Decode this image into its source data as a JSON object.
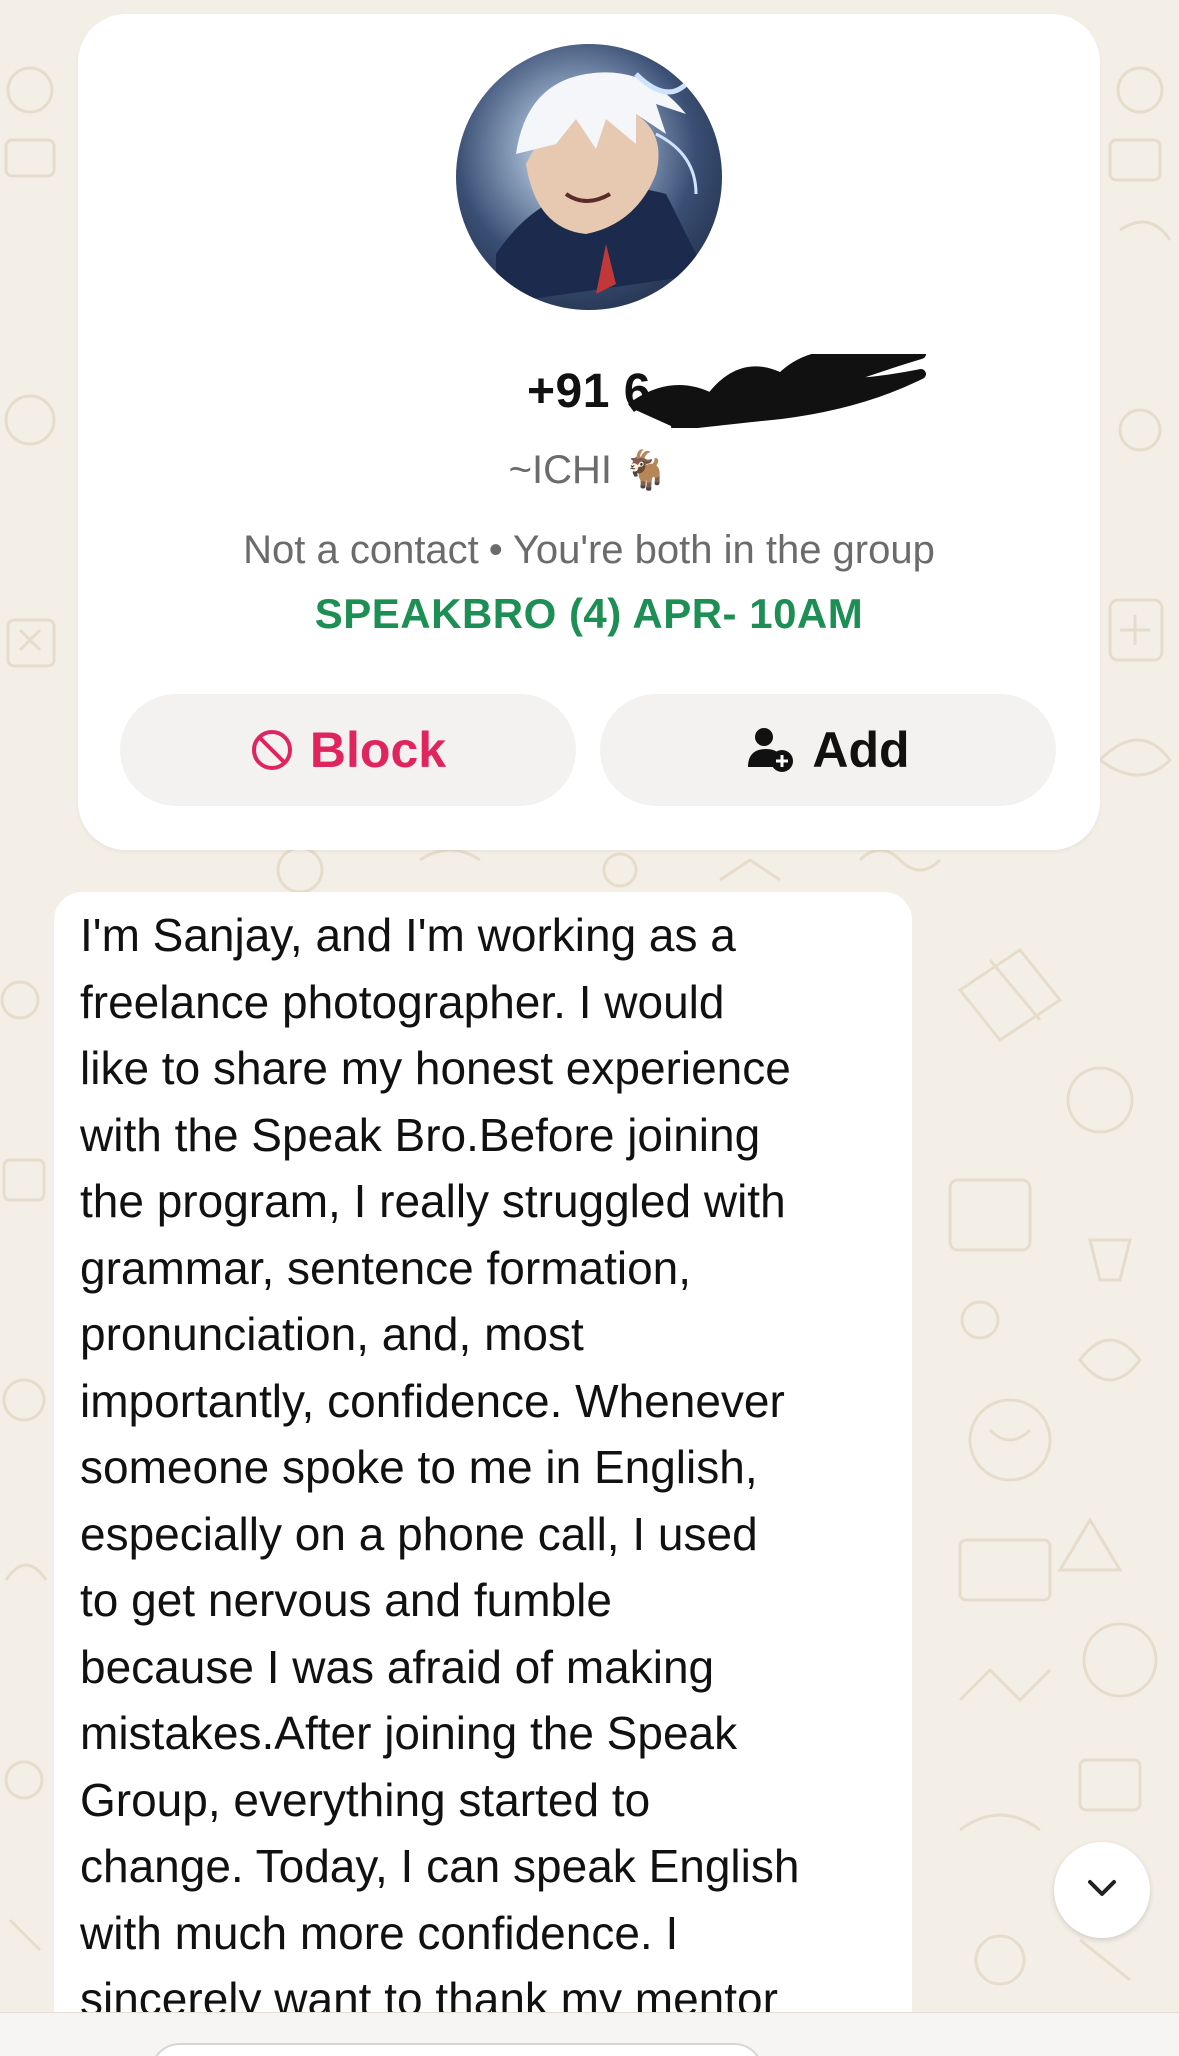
{
  "contact": {
    "phone": "+91 6",
    "display_name": "~ICHI",
    "name_emoji": "🐐",
    "status": "Not a contact",
    "separator": "•",
    "context": "You're both in the group",
    "group_name": "SPEAKBRO (4) APR- 10AM"
  },
  "actions": {
    "block_label": "Block",
    "add_label": "Add"
  },
  "message": {
    "lines": [
      "I'm Sanjay, and I'm working as a",
      "freelance photographer. I would",
      "like to share my honest experience",
      "with the Speak Bro.Before joining",
      "the program, I really struggled with",
      "grammar, sentence formation,",
      "pronunciation, and, most",
      "importantly, confidence. Whenever",
      "someone spoke to me in English,",
      "especially on a phone call, I used",
      "to get nervous and fumble",
      "because I was afraid of making",
      "mistakes.After joining the Speak",
      "Group, everything started to",
      "change. Today, I can speak English",
      "with much more confidence. I",
      "sincerely want to thank my mentor"
    ]
  },
  "icons": {
    "avatar": "anime-character-avatar",
    "block": "block-icon",
    "add": "add-person-icon",
    "scroll": "chevron-down-icon"
  },
  "colors": {
    "group_name": "#1d8f55",
    "block": "#e0245e",
    "background": "#f4efe6"
  }
}
